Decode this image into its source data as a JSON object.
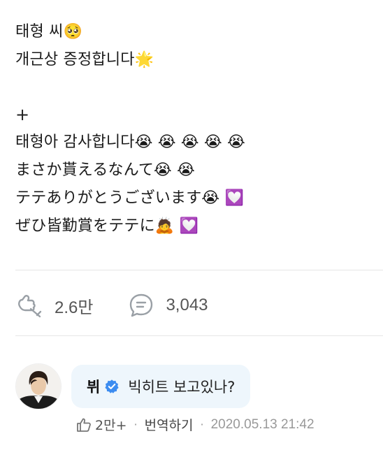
{
  "post": {
    "lines": [
      "태형 씨🥺",
      "개근상 증정합니다🌟",
      "",
      "+",
      "태형아 감사합니다😭 😭 😭 😭 😭",
      "まさか貰えるなんて😭 😭",
      "テテありがとうございます😭 💟",
      "ぜひ皆勤賞をテテに🙇 💟"
    ]
  },
  "stats": {
    "likes": "2.6만",
    "comments": "3,043"
  },
  "comment": {
    "author": "뷔",
    "text": "빅히트 보고있나?",
    "likes": "2만+",
    "translate": "번역하기",
    "timestamp": "2020.05.13 21:42",
    "separator": "·"
  },
  "icons": {
    "like": "like-icon",
    "comment": "comment-icon",
    "verified": "verified-badge-icon",
    "thumb": "thumb-up-icon"
  },
  "colors": {
    "verified": "#3c8cf0",
    "bubble": "#eef6fc",
    "icon_gray": "#9aa0a6"
  }
}
